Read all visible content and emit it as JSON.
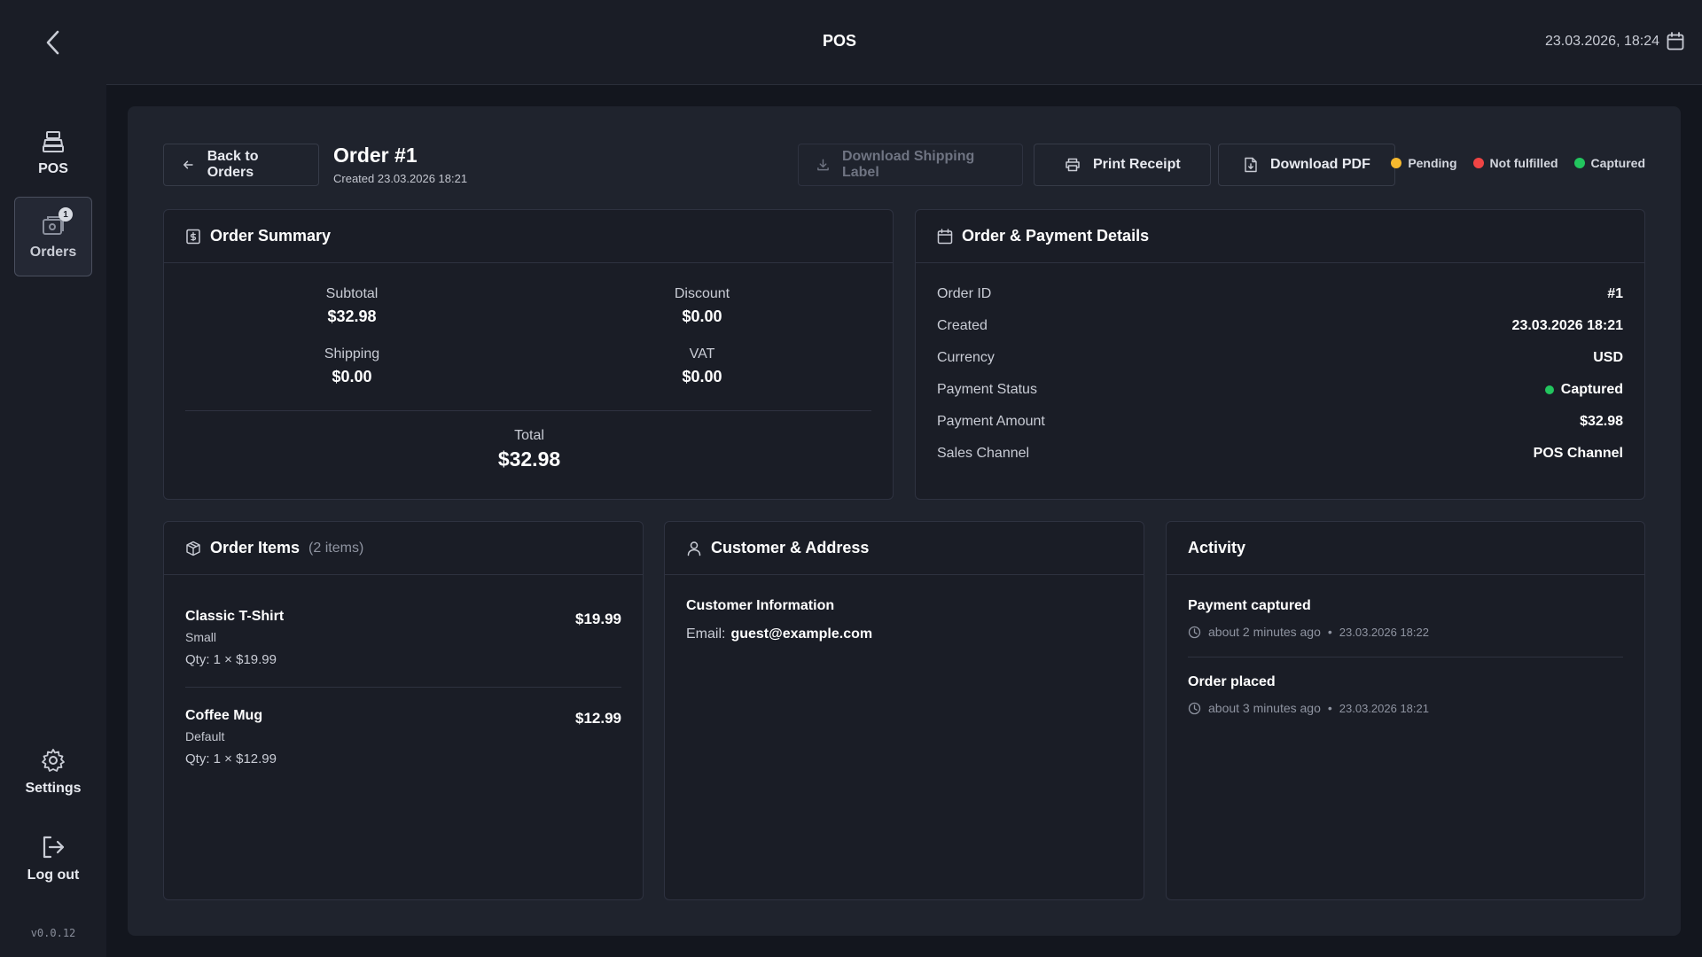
{
  "app": {
    "title": "POS",
    "datetime": "23.03.2026, 18:24",
    "version": "v0.0.12"
  },
  "sidebar": {
    "pos_label": "POS",
    "orders_label": "Orders",
    "orders_badge": "1",
    "settings_label": "Settings",
    "logout_label": "Log out"
  },
  "header": {
    "back_label": "Back to Orders",
    "order_title": "Order #1",
    "created": "Created 23.03.2026 18:21",
    "download_shipping_label": "Download Shipping Label",
    "print_receipt": "Print Receipt",
    "download_pdf": "Download PDF",
    "statuses": [
      {
        "label": "Pending",
        "color": "#f5b82e"
      },
      {
        "label": "Not fulfilled",
        "color": "#ef4444"
      },
      {
        "label": "Captured",
        "color": "#22c55e"
      }
    ]
  },
  "summary": {
    "title": "Order Summary",
    "subtotal_label": "Subtotal",
    "subtotal": "$32.98",
    "discount_label": "Discount",
    "discount": "$0.00",
    "shipping_label": "Shipping",
    "shipping": "$0.00",
    "vat_label": "VAT",
    "vat": "$0.00",
    "total_label": "Total",
    "total": "$32.98"
  },
  "details": {
    "title": "Order & Payment Details",
    "rows": [
      {
        "key": "Order ID",
        "value": "#1"
      },
      {
        "key": "Created",
        "value": "23.03.2026 18:21"
      },
      {
        "key": "Currency",
        "value": "USD"
      },
      {
        "key": "Payment Status",
        "value": "Captured"
      },
      {
        "key": "Payment Amount",
        "value": "$32.98"
      },
      {
        "key": "Sales Channel",
        "value": "POS Channel"
      }
    ],
    "captured_color": "#22c55e"
  },
  "items": {
    "title": "Order Items",
    "count": "(2 items)",
    "list": [
      {
        "name": "Classic T-Shirt",
        "variant": "Small",
        "qty": "Qty: 1 × $19.99",
        "price": "$19.99"
      },
      {
        "name": "Coffee Mug",
        "variant": "Default",
        "qty": "Qty: 1 × $12.99",
        "price": "$12.99"
      }
    ]
  },
  "customer": {
    "title": "Customer & Address",
    "section": "Customer Information",
    "email_label": "Email:",
    "email": "guest@example.com"
  },
  "activity": {
    "title": "Activity",
    "events": [
      {
        "title": "Payment captured",
        "ago": "about 2 minutes ago",
        "time": "23.03.2026 18:22"
      },
      {
        "title": "Order placed",
        "ago": "about 3 minutes ago",
        "time": "23.03.2026 18:21"
      }
    ]
  }
}
